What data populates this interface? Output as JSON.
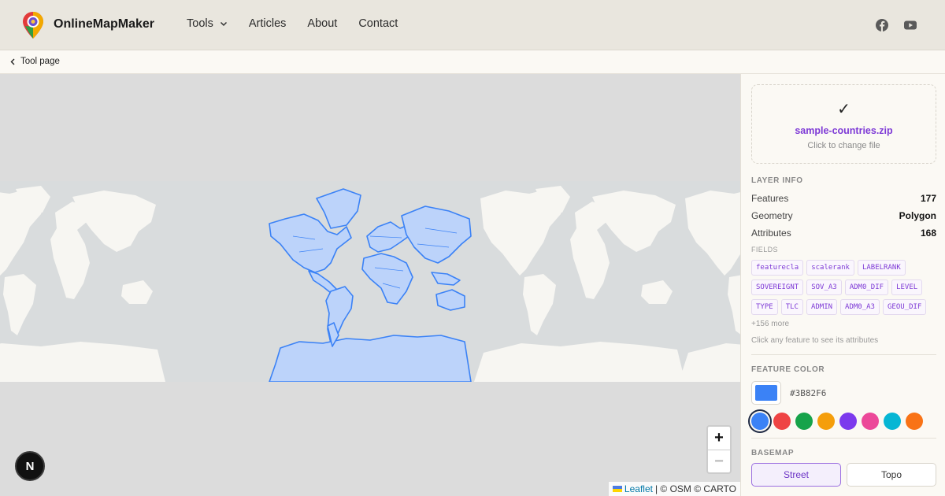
{
  "header": {
    "brand": "OnlineMapMaker",
    "nav": [
      "Tools",
      "Articles",
      "About",
      "Contact"
    ]
  },
  "breadcrumb": {
    "label": "Tool page"
  },
  "map": {
    "attribution_leaflet": "Leaflet",
    "attribution_rest": "| © OSM © CARTO",
    "zoom_in": "+",
    "zoom_out": "−",
    "badge": "N"
  },
  "sidebar": {
    "upload": {
      "check": "✓",
      "filename": "sample-countries.zip",
      "change": "Click to change file"
    },
    "layer_info": {
      "title": "LAYER INFO",
      "rows": [
        {
          "label": "Features",
          "value": "177"
        },
        {
          "label": "Geometry",
          "value": "Polygon"
        },
        {
          "label": "Attributes",
          "value": "168"
        }
      ],
      "fields_label": "FIELDS",
      "fields": [
        "featurecla",
        "scalerank",
        "LABELRANK",
        "SOVEREIGNT",
        "SOV_A3",
        "ADM0_DIF",
        "LEVEL",
        "TYPE",
        "TLC",
        "ADMIN",
        "ADM0_A3",
        "GEOU_DIF"
      ],
      "more": "+156 more",
      "hint": "Click any feature to see its attributes"
    },
    "feature_color": {
      "title": "FEATURE COLOR",
      "hex": "#3B82F6",
      "palette": [
        "#3B82F6",
        "#EF4444",
        "#16A34A",
        "#F59E0B",
        "#7C3AED",
        "#EC4899",
        "#06B6D4",
        "#F97316"
      ]
    },
    "basemap": {
      "title": "BASEMAP",
      "options": [
        "Street",
        "Topo"
      ],
      "active": "Street"
    }
  }
}
